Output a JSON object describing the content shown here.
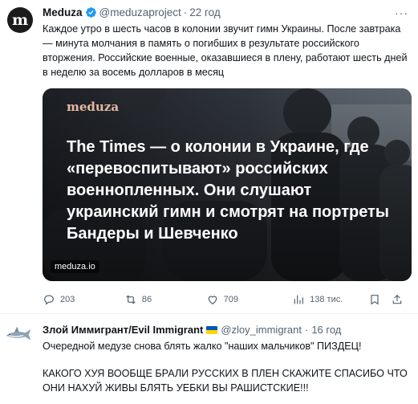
{
  "tweet": {
    "avatar_letter": "m",
    "author_name": "Meduza",
    "author_handle": "@meduzaproject",
    "separator": "·",
    "time": "22 год",
    "more_label": "···",
    "text": "Каждое утро в шесть часов в колонии звучит гимн Украины. После завтрака — минута молчания в память о погибших в результате российского вторжения. Российские военные, оказавшиеся в плену, работают шесть дней в неделю за восемь долларов в месяц",
    "card": {
      "logo": "meduza",
      "headline": "The Times — о колонии в Украине, где «перевоспитывают» российских военнопленных. Они слушают украинский гимн и смотрят на портреты Бандеры и Шевченко",
      "source": "meduza.io"
    },
    "actions": {
      "reply_count": "203",
      "retweet_count": "86",
      "like_count": "709",
      "views_count": "138 тис."
    }
  },
  "reply": {
    "author_name": "Злой Иммигрант/Evil Immigrant",
    "author_handle": "@zloy_immigrant",
    "separator": "·",
    "time": "16 год",
    "line1": "Очередной медузе снова блять жалко \"наших мальчиков\" ПИЗДЕЦ!",
    "line2": "КАКОГО ХУЯ ВООБЩЕ БРАЛИ РУССКИХ В ПЛЕН СКАЖИТЕ СПАСИБО ЧТО ОНИ НАХУЙ ЖИВЫ БЛЯТЬ УЕБКИ ВЫ РАШИСТСКИЕ!!!"
  },
  "colors": {
    "text": "#0f1419",
    "muted": "#536471",
    "verified": "#1d9bf0",
    "logo": "#e7b9a3"
  }
}
